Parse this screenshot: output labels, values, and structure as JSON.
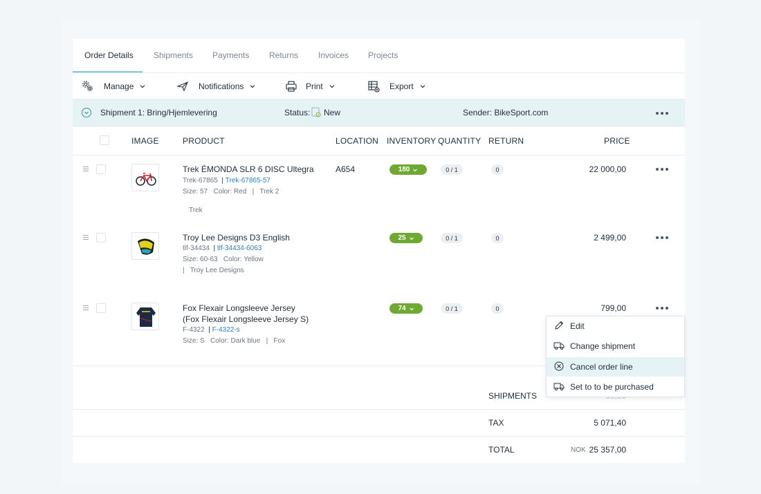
{
  "tabs": [
    "Order Details",
    "Shipments",
    "Payments",
    "Returns",
    "Invoices",
    "Projects"
  ],
  "toolbar": {
    "manage": "Manage",
    "notifications": "Notifications",
    "print": "Print",
    "export": "Export"
  },
  "shipment": {
    "title": "Shipment 1: Bring/Hjemlevering",
    "status_label": "Status:",
    "status_value": "New",
    "sender": "Sender: BikeSport.com"
  },
  "columns": {
    "image": "IMAGE",
    "product": "PRODUCT",
    "location": "LOCATION",
    "inventory": "INVENTORY",
    "quantity": "QUANTITY",
    "return": "RETURN",
    "price": "PRICE"
  },
  "rows": [
    {
      "name": "Trek ÉMONDA SLR 6 DISC Ultegra",
      "sku": "Trek-67865",
      "variant_sku": "Trek-67865-57",
      "attrs": "Size: 57   Color: Red   |   Trek 2",
      "extra": "Trek",
      "location": "A654",
      "inventory": "180",
      "quantity": "0 / 1",
      "return": "0",
      "price": "22 000,00"
    },
    {
      "name": "Troy Lee Designs D3 English",
      "sku": "tlf-34434",
      "variant_sku": "tlf-34434-6063",
      "attrs": "Size: 60-63   Color: Yellow",
      "extra": "|   Troy Lee Designs",
      "location": "",
      "inventory": "25",
      "quantity": "0 / 1",
      "return": "0",
      "price": "2 499,00"
    },
    {
      "name": "Fox Flexair Longsleeve Jersey",
      "name2": "(Fox Flexair Longsleeve Jersey S)",
      "sku": "F-4322",
      "variant_sku": "F-4322-s",
      "attrs": "Size: S   Color: Dark blue   |   Fox",
      "location": "",
      "inventory": "74",
      "quantity": "0 / 1",
      "return": "0",
      "price": "799,00"
    }
  ],
  "summary": {
    "shipments_label": "SHIPMENTS",
    "shipments_value": "00,00",
    "tax_label": "TAX",
    "tax_value": "5 071,40",
    "total_label": "TOTAL",
    "currency": "NOK",
    "total_value": "25 357,00"
  },
  "menu": {
    "edit": "Edit",
    "change_shipment": "Change shipment",
    "cancel": "Cancel order line",
    "purchase": "Set to to be purchased"
  },
  "colors": {
    "accent": "#7fc6d6",
    "inventory_badge": "#6fa832",
    "shipment_bar": "#e6f3f5",
    "link": "#2e7fb2"
  }
}
